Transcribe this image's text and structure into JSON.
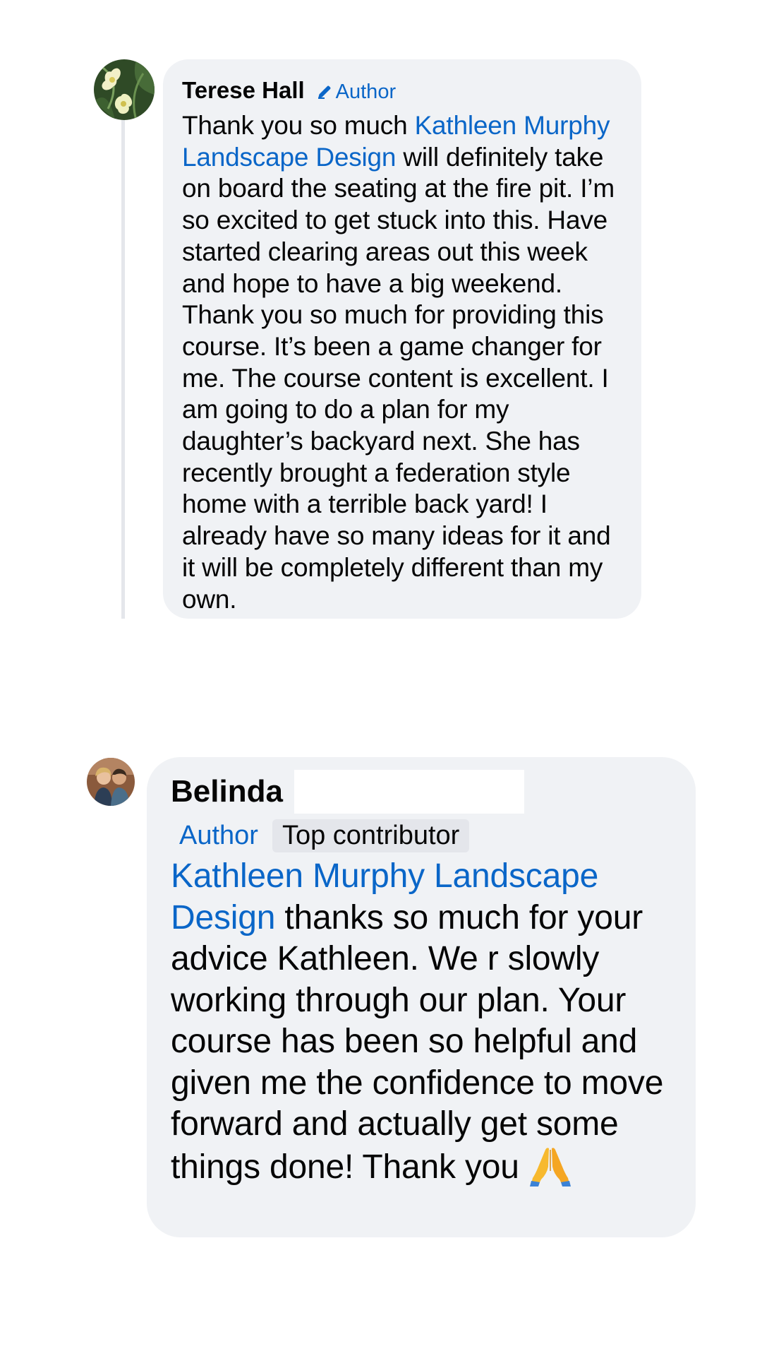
{
  "comments": [
    {
      "author_name": "Terese Hall",
      "badge": "Author",
      "mention": "Kathleen Murphy Landscape Design",
      "text_before": "Thank you so much ",
      "text_after": " will definitely take on board the seating at the fire pit. I’m so excited to get stuck into this. Have started clearing areas out this week and hope to have a big weekend. Thank you so much for providing this course. It’s been a game changer for me. The course content is excellent. I am going to do a plan for my daughter’s backyard next. She has recently brought a federation style home with a terrible back yard! I already have so many ideas for it and it will be completely different than my own."
    },
    {
      "author_name": "Belinda",
      "badge_author": "Author",
      "badge_top": "Top contributor",
      "mention": "Kathleen Murphy Landscape Design",
      "text_after": " thanks so much for your advice Kathleen. We r slowly working through our plan. Your course has been so helpful and given me the confidence to move forward and actually get some things done! Thank you ",
      "emoji": "praying-hands-icon"
    }
  ],
  "colors": {
    "bubble_bg": "#f0f2f5",
    "link_blue": "#0a66c8",
    "thread_line": "#e4e6eb"
  }
}
